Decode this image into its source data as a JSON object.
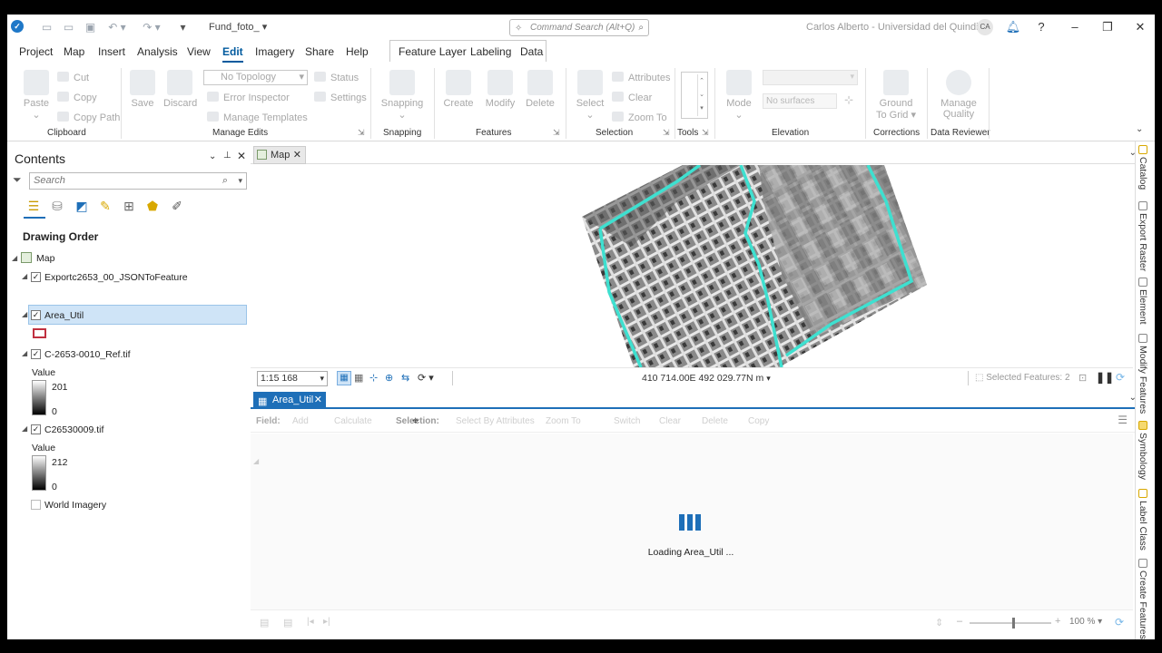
{
  "titlebar": {
    "project_name": "Fund_foto_",
    "command_search_placeholder": "Command Search (Alt+Q)",
    "user": "Carlos Alberto - Universidad del Quindio",
    "user_initials": "CA"
  },
  "ribbon_tabs": [
    "Project",
    "Map",
    "Insert",
    "Analysis",
    "View",
    "Edit",
    "Imagery",
    "Share",
    "Help"
  ],
  "context_tabs": [
    "Feature Layer",
    "Labeling",
    "Data"
  ],
  "ribbon": {
    "clipboard": {
      "paste": "Paste",
      "cut": "Cut",
      "copy": "Copy",
      "copy_path": "Copy Path",
      "label": "Clipboard"
    },
    "manage_edits": {
      "save": "Save",
      "discard": "Discard",
      "topology": "No Topology",
      "status": "Status",
      "error_inspector": "Error Inspector",
      "settings": "Settings",
      "manage_templates": "Manage Templates",
      "label": "Manage Edits"
    },
    "snapping": {
      "snapping": "Snapping",
      "label": "Snapping"
    },
    "features": {
      "create": "Create",
      "modify": "Modify",
      "delete": "Delete",
      "label": "Features"
    },
    "selection": {
      "select": "Select",
      "attributes": "Attributes",
      "clear": "Clear",
      "zoom_to": "Zoom To",
      "label": "Selection"
    },
    "tools": {
      "label": "Tools"
    },
    "elevation": {
      "mode": "Mode",
      "surfaces": "No surfaces",
      "label": "Elevation"
    },
    "corrections": {
      "ground_to_grid_1": "Ground",
      "ground_to_grid_2": "To Grid",
      "label": "Corrections"
    },
    "data_reviewer": {
      "manage_1": "Manage",
      "manage_2": "Quality",
      "label": "Data Reviewer"
    }
  },
  "contents": {
    "title": "Contents",
    "search_placeholder": "Search",
    "drawing_order": "Drawing Order",
    "map_label": "Map",
    "layers": {
      "export": "Exportc2653_00_JSONToFeature",
      "area_util": "Area_Util",
      "ref_tif": "C-2653-0010_Ref.tif",
      "c_tif": "C26530009.tif",
      "world": "World Imagery"
    },
    "value_label": "Value",
    "ref_max": "201",
    "ref_min": "0",
    "c_max": "212",
    "c_min": "0"
  },
  "map": {
    "tab_label": "Map",
    "scale": "1:15 168",
    "coords": "410 714.00E 492 029.77N m",
    "selected_features": "Selected Features: 2"
  },
  "table": {
    "tab_label": "Area_Util",
    "field_label": "Field:",
    "tools": [
      "Add",
      "Calculate",
      "Selection:",
      "Select By Attributes",
      "Zoom To",
      "Switch",
      "Clear",
      "Delete",
      "Copy"
    ],
    "loading": "Loading Area_Util ...",
    "zoom": "100 %"
  },
  "right_dock": [
    "Catalog",
    "Export Raster",
    "Element",
    "Modify Features",
    "Symbology",
    "Label Class",
    "Create Features"
  ],
  "colors": {
    "accent": "#1e6fb8",
    "boundary": "#3ee0d0"
  }
}
